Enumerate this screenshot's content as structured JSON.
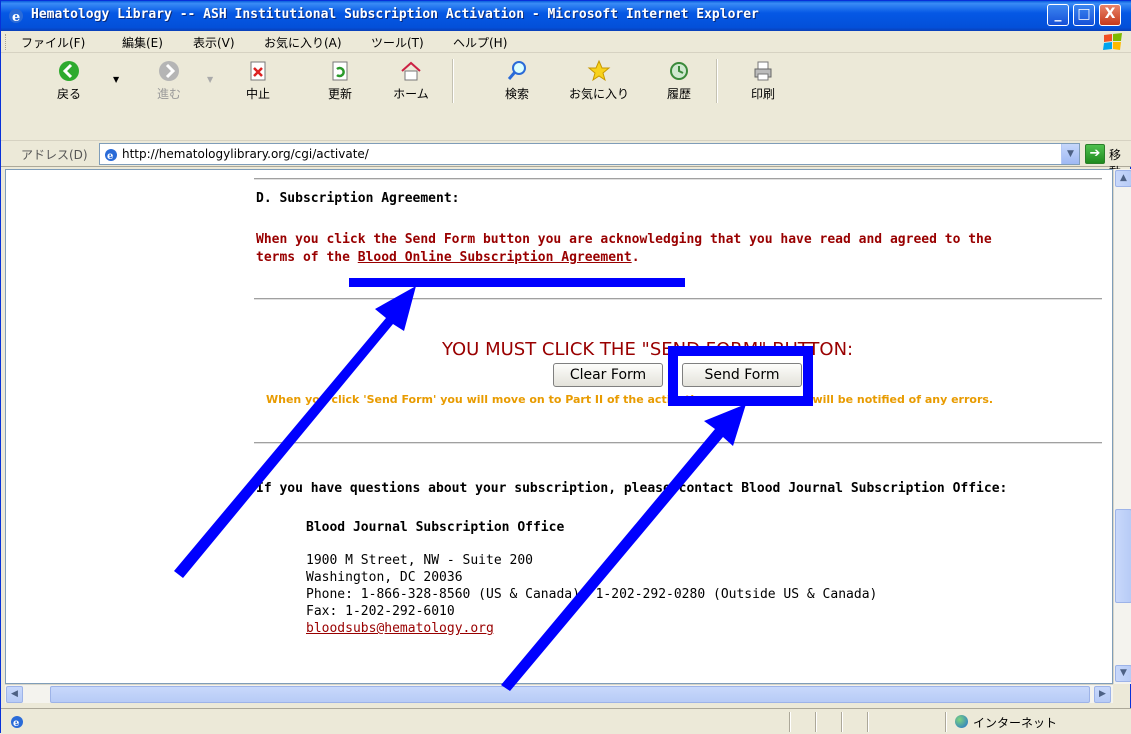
{
  "window": {
    "title": "Hematology Library -- ASH Institutional Subscription Activation - Microsoft Internet Explorer",
    "minimize_glyph": "_",
    "maximize_glyph": "□",
    "close_glyph": "X"
  },
  "menu": {
    "items": [
      "ファイル(F)",
      "編集(E)",
      "表示(V)",
      "お気に入り(A)",
      "ツール(T)",
      "ヘルプ(H)"
    ]
  },
  "toolbar": {
    "back": "戻る",
    "forward": "進む",
    "stop": "中止",
    "refresh": "更新",
    "home": "ホーム",
    "search": "検索",
    "favorites": "お気に入り",
    "history": "履歴",
    "print": "印刷"
  },
  "address": {
    "label": "アドレス(D)",
    "url": "http://hematologylibrary.org/cgi/activate/",
    "go_label": "移動"
  },
  "page": {
    "section_title": "D. Subscription Agreement:",
    "ack_line1": "When you click the Send Form button you are acknowledging that you have read and agreed to the",
    "ack_line2_prefix": "terms of the ",
    "ack_link": "Blood Online Subscription Agreement",
    "ack_line2_suffix": ".",
    "must_click": "YOU MUST CLICK THE \"SEND FORM\" BUTTON:",
    "clear_form": "Clear Form",
    "send_form": "Send Form",
    "note": "When you click 'Send Form' you will move on to Part II of the activation process, or you will be notified of any errors.",
    "questions": "If you have questions about your subscription, please contact Blood Journal Subscription Office:",
    "office_name": "Blood Journal Subscription Office",
    "address_lines": [
      "1900 M Street, NW - Suite 200",
      "Washington, DC 20036",
      "Phone: 1-866-328-8560 (US & Canada), 1-202-292-0280 (Outside US & Canada)",
      "Fax: 1-202-292-6010"
    ],
    "email": "bloodsubs@hematology.org"
  },
  "statusbar": {
    "zone": "インターネット"
  },
  "annotations": {
    "color": "#0000ff"
  }
}
